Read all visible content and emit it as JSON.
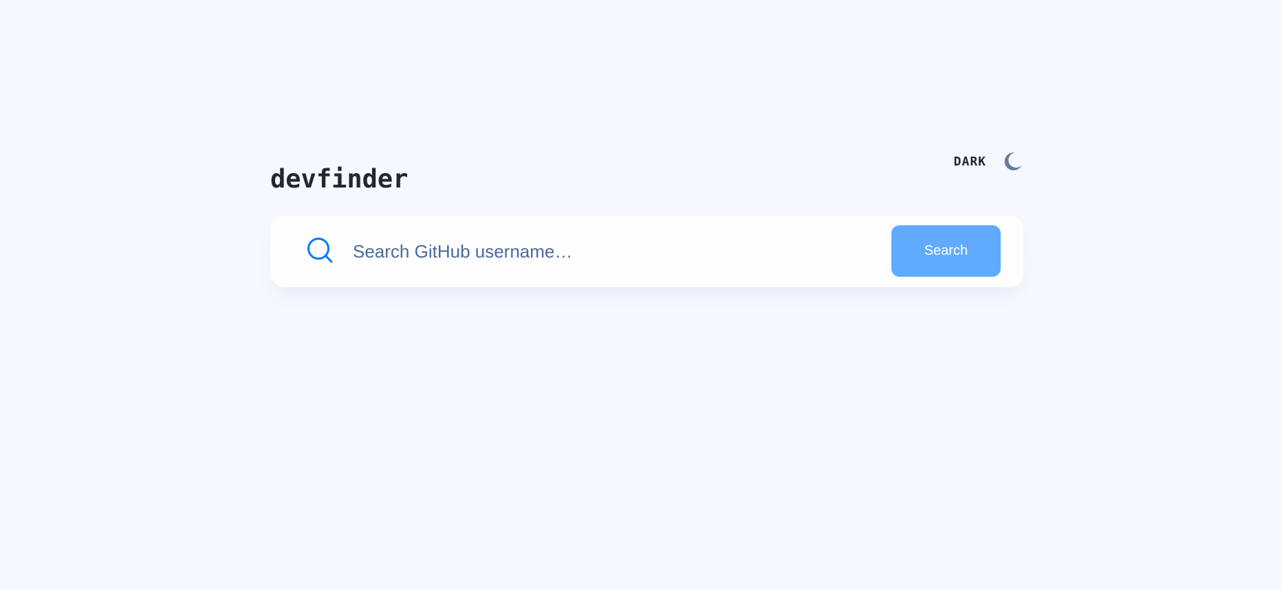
{
  "app": {
    "title": "devfinder"
  },
  "theme_toggle": {
    "label": "DARK",
    "icon": "moon-icon"
  },
  "search": {
    "icon": "search-icon",
    "placeholder": "Search GitHub username…",
    "value": "",
    "button_label": "Search"
  },
  "colors": {
    "background": "#f5f8ff",
    "card": "#fefefe",
    "accent": "#0079ff",
    "button": "#60abff",
    "text_dark": "#222731",
    "text_muted": "#4b6a9b",
    "moon": "#697c9a"
  }
}
